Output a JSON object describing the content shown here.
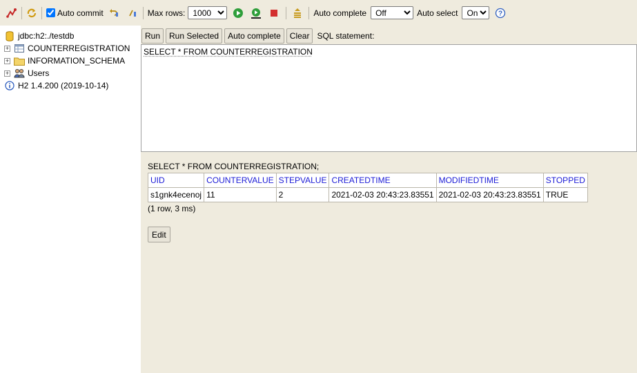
{
  "toolbar": {
    "auto_commit_label": "Auto commit",
    "max_rows_label": "Max rows:",
    "max_rows_value": "1000",
    "auto_complete_label": "Auto complete",
    "auto_complete_value": "Off",
    "auto_select_label": "Auto select",
    "auto_select_value": "On",
    "help_label": "?"
  },
  "tree": {
    "connection": "jdbc:h2:./testdb",
    "items": [
      {
        "label": "COUNTERREGISTRATION"
      },
      {
        "label": "INFORMATION_SCHEMA"
      },
      {
        "label": "Users"
      }
    ],
    "version": "H2 1.4.200 (2019-10-14)"
  },
  "query": {
    "run": "Run",
    "run_selected": "Run Selected",
    "auto_complete": "Auto complete",
    "clear": "Clear",
    "statement_label": "SQL statement:",
    "sql_text": "SELECT * FROM COUNTERREGISTRATION"
  },
  "result": {
    "sql": "SELECT * FROM COUNTERREGISTRATION;",
    "columns": [
      "UID",
      "COUNTERVALUE",
      "STEPVALUE",
      "CREATEDTIME",
      "MODIFIEDTIME",
      "STOPPED"
    ],
    "rows": [
      [
        "s1gnk4ecenoj",
        "11",
        "2",
        "2021-02-03 20:43:23.83551",
        "2021-02-03 20:43:23.83551",
        "TRUE"
      ]
    ],
    "row_count": "(1 row, 3 ms)",
    "edit": "Edit"
  }
}
